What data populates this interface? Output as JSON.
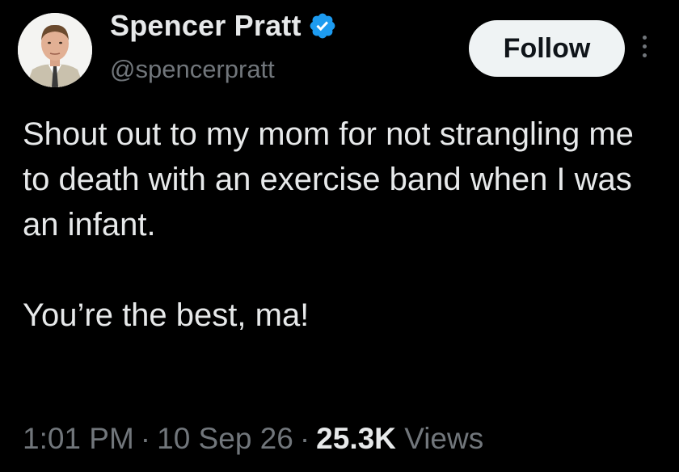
{
  "tweet": {
    "author": {
      "display_name": "Spencer Pratt",
      "handle": "@spencerpratt",
      "verified": true,
      "avatar_icon": "user-avatar-icon"
    },
    "follow_label": "Follow",
    "more_icon": "more-options-icon",
    "text_line1": "Shout out to my mom for not strangling me to death with an exercise band when I was an infant.",
    "text_line2": "You’re the best, ma!",
    "time": "1:01 PM",
    "date": "10 Sep 26",
    "views_count": "25.3K",
    "views_label": "Views"
  },
  "colors": {
    "background": "#000000",
    "text_primary": "#e7e9ea",
    "text_secondary": "#71767b",
    "verified_blue": "#1d9bf0",
    "follow_button_bg": "#eff3f4"
  }
}
